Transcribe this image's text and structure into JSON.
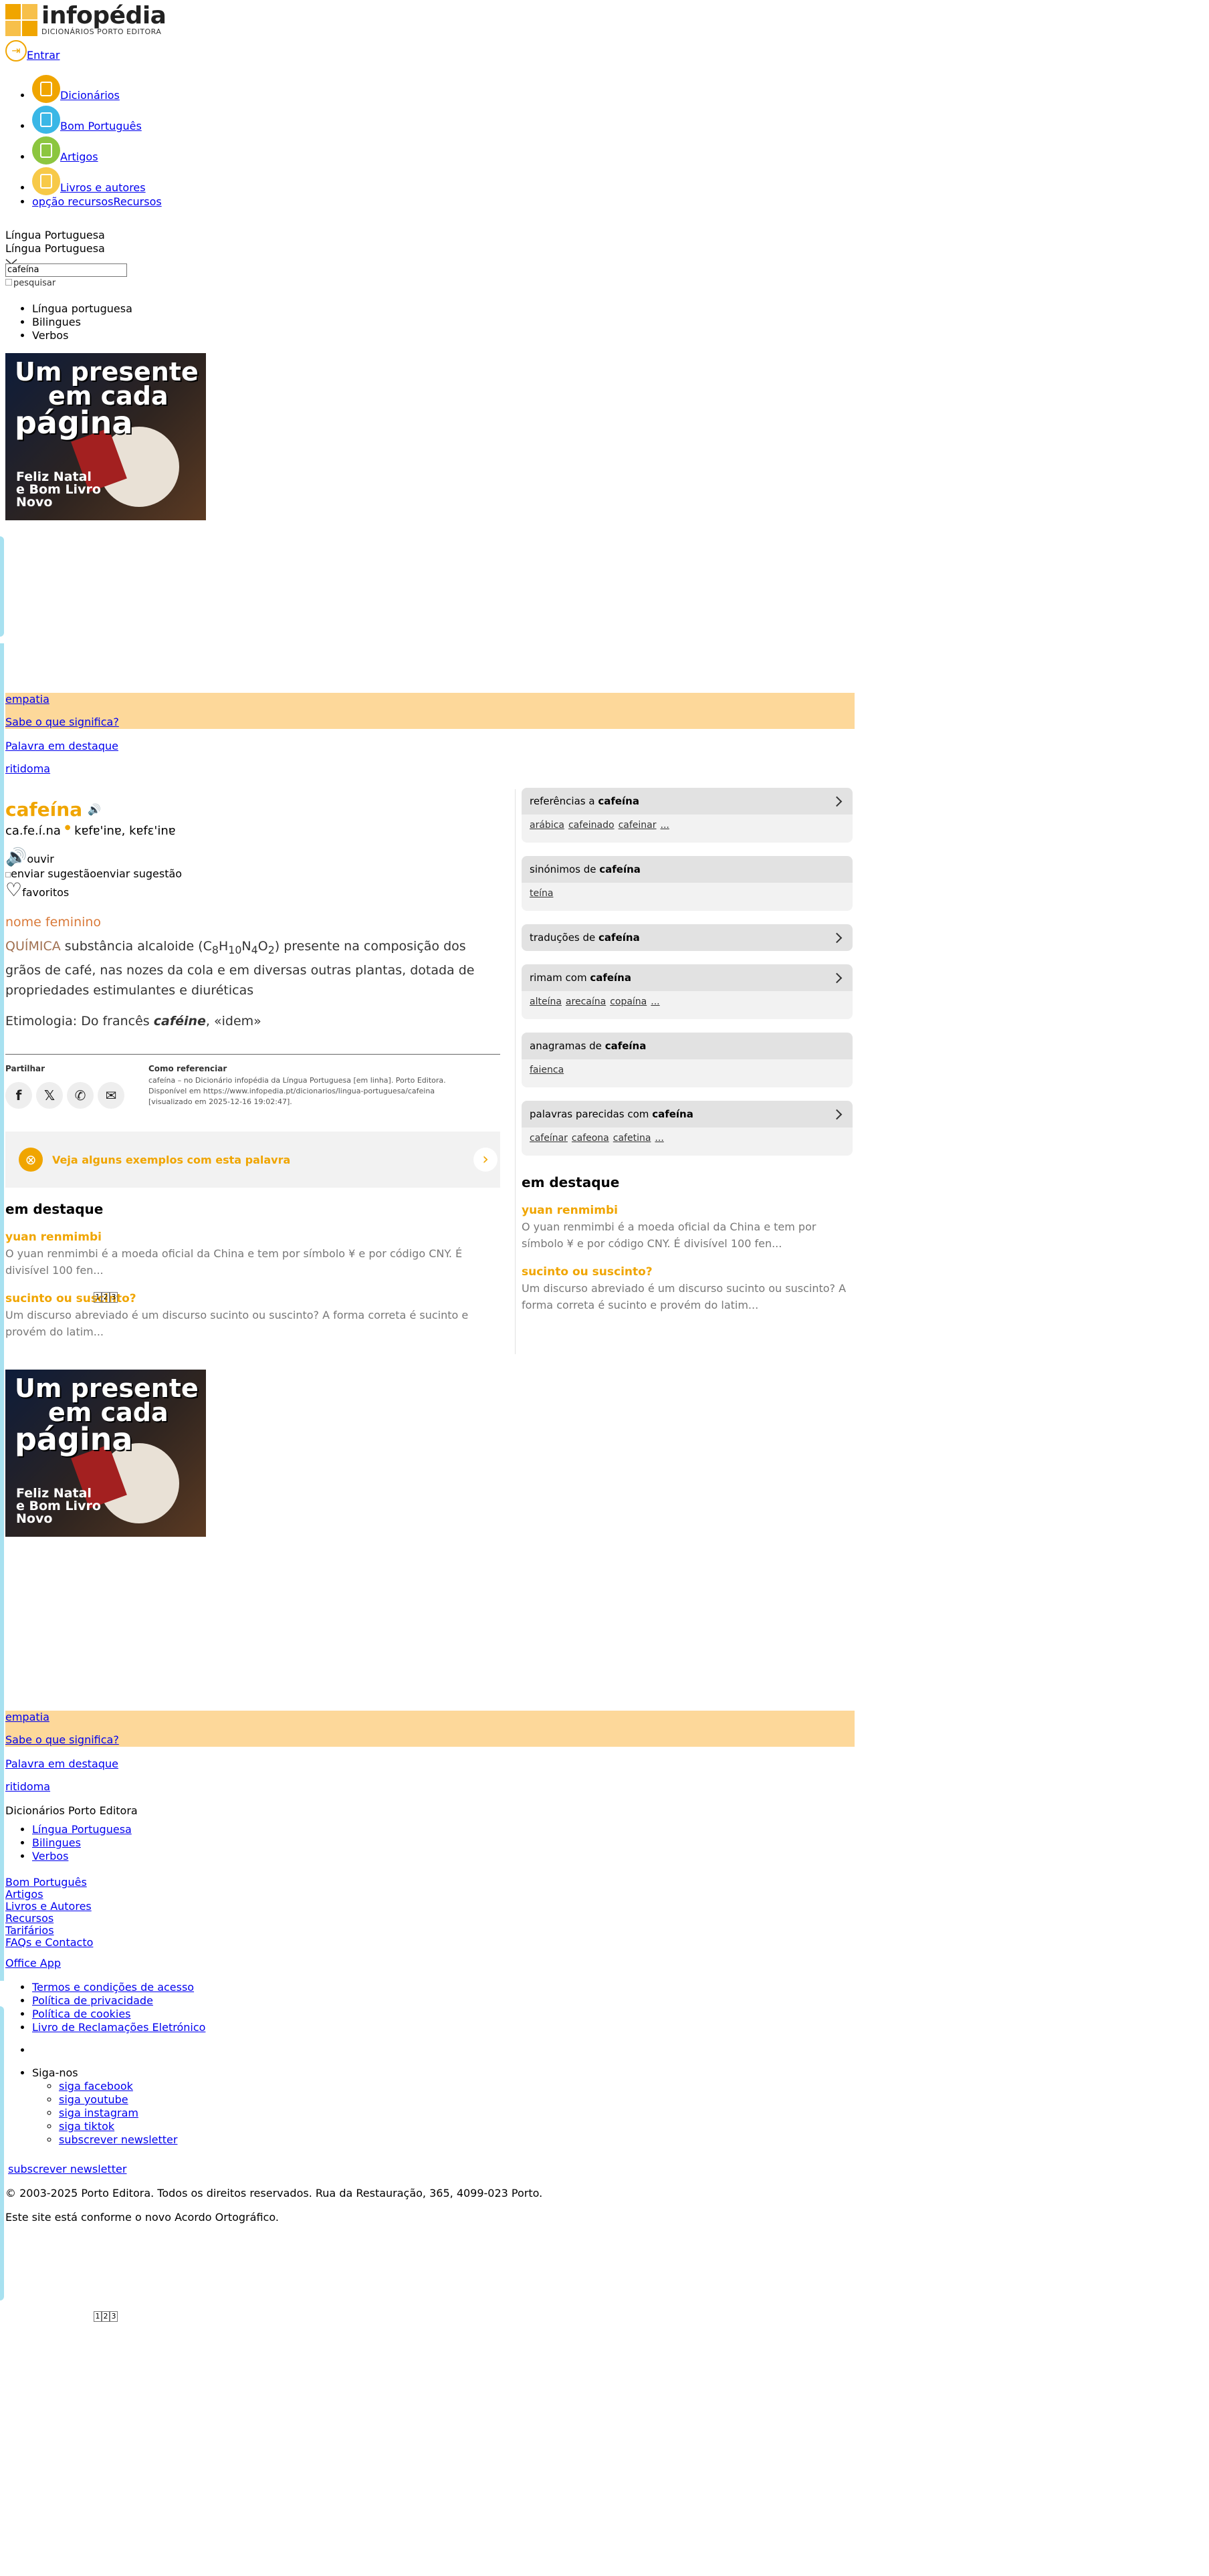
{
  "header": {
    "logo_name": "infopédia",
    "logo_sub": "DICIONÁRIOS PORTO EDITORA",
    "login_label": "Entrar"
  },
  "nav": {
    "items": [
      {
        "label": "Dicionários",
        "color": "#f0a500"
      },
      {
        "label": "Bom Português",
        "color": "#3ab7e6"
      },
      {
        "label": "Artigos",
        "color": "#8cc63f"
      },
      {
        "label": "Livros e autores",
        "color": "#f7c948"
      }
    ],
    "resources_alt": "opção recursos",
    "resources_label": "Recursos"
  },
  "search": {
    "lang_selected": "Língua Portuguesa",
    "lang_display": "Língua Portuguesa",
    "query": "cafeína",
    "button_alt": "pesquisar",
    "options": [
      "Língua portuguesa",
      "Bilingues",
      "Verbos"
    ]
  },
  "banner": {
    "line1": "Um presente",
    "line2": "em cada",
    "line3": "página",
    "sub1": "Feliz Natal",
    "sub2": "e Bom Livro",
    "sub3": "Novo"
  },
  "highlights": {
    "word": "empatia",
    "question": "Sabe o que significa?",
    "featured": "Palavra em destaque",
    "ritidoma": "ritidoma"
  },
  "entry": {
    "word": "cafeína",
    "syllables": "ca.fe.í.na",
    "pron": "kɐfɐ'inɐ, kɐfɛ'inɐ",
    "listen": "ouvir",
    "suggest_alt": "enviar sugestão",
    "suggest": "enviar sugestão",
    "favorites": "favoritos",
    "pos": "nome feminino",
    "domain": "QUÍMICA",
    "def_pre": "substância alcaloide (C",
    "sub1": "8",
    "h": "H",
    "sub2": "10",
    "n": "N",
    "sub3": "4",
    "o": "O",
    "sub4": "2",
    "def_post": ") presente na composição dos grãos de café, nas nozes da cola e em diversas outras plantas, dotada de propriedades estimulantes e diuréticas",
    "etym_pre": "Etimologia: Do francês ",
    "etym_word": "caféine",
    "etym_post": ", «idem»"
  },
  "share": {
    "label": "Partilhar",
    "cite_title": "Como referenciar",
    "cite_text": "cafeína – no Dicionário infopédia da Língua Portuguesa [em linha]. Porto Editora. Disponível em https://www.infopedia.pt/dicionarios/lingua-portuguesa/cafeina [visualizado em 2025-12-16 19:02:47]."
  },
  "examples": {
    "label": "Veja alguns exemplos com esta palavra"
  },
  "featured": {
    "title": "em destaque",
    "items": [
      {
        "title": "yuan renmimbi",
        "text": "O yuan renmimbi é a moeda oficial da China e tem por símbolo ¥ e por código CNY. É divisível 100 fen..."
      },
      {
        "title": "sucinto ou suscinto?",
        "text": "Um discurso abreviado é um discurso sucinto ou suscinto? A forma correta é sucinto e provém do latim..."
      }
    ]
  },
  "sidebar": {
    "cards": [
      {
        "prefix": "referências a ",
        "bold": "cafeína",
        "links": [
          "arábica",
          "cafeinado",
          "cafeinar",
          "..."
        ],
        "chevron": true
      },
      {
        "prefix": "sinónimos de ",
        "bold": "cafeína",
        "links": [
          "teína"
        ],
        "chevron": false
      },
      {
        "prefix": "traduções de ",
        "bold": "cafeína",
        "links": [],
        "chevron": true
      },
      {
        "prefix": "rimam com ",
        "bold": "cafeína",
        "links": [
          "alteína",
          "arecaína",
          "copaína",
          "..."
        ],
        "chevron": true
      },
      {
        "prefix": "anagramas de ",
        "bold": "cafeína",
        "links": [
          "faienca"
        ],
        "chevron": false
      },
      {
        "prefix": "palavras parecidas com ",
        "bold": "cafeína",
        "links": [
          "cafeínar",
          "cafeona",
          "cafetina",
          "..."
        ],
        "chevron": true
      }
    ]
  },
  "pager": {
    "p1": "1",
    "p2": "2",
    "p3": "3"
  },
  "footer": {
    "heading": "Dicionários Porto Editora",
    "dict_links": [
      "Língua Portuguesa",
      "Bilingues",
      "Verbos"
    ],
    "links": [
      "Bom Português",
      "Artigos",
      "Livros e Autores",
      "Recursos",
      "Tarifários",
      "FAQs e Contacto"
    ],
    "office": "Office App",
    "legal": [
      "Termos e condições de acesso",
      "Política de privacidade",
      "Política de cookies",
      "Livro de Reclamações Eletrónico"
    ],
    "follow": "Siga-nos",
    "social": [
      "siga facebook",
      "siga youtube",
      "siga instagram",
      "siga tiktok"
    ],
    "newsletter": "subscrever newsletter",
    "newsletter2": "subscrever newsletter",
    "copyright": "© 2003-2025 Porto Editora. Todos os direitos reservados. Rua da Restauração, 365, 4099-023 Porto.",
    "ortho": "Este site está conforme o novo Acordo Ortográfico."
  }
}
